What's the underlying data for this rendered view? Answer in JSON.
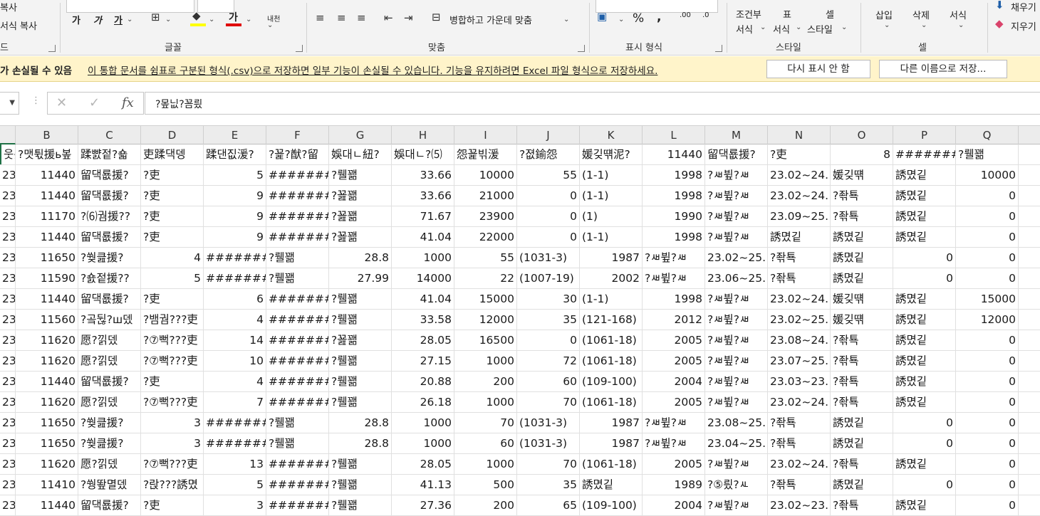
{
  "ribbon": {
    "clipboard": {
      "copy_label": "복사",
      "format_painter_label": "서식 복사",
      "group_label": "드"
    },
    "font": {
      "bold": "가",
      "italic": "가",
      "underline": "가",
      "group_label": "글꼴",
      "wrap": "내천"
    },
    "alignment": {
      "merge_label": "병합하고 가운데 맞춤",
      "group_label": "맞춤"
    },
    "number": {
      "percent": "%",
      "comma": ",",
      "inc_decimal": ".00",
      "dec_decimal": ".0",
      "group_label": "표시 형식"
    },
    "styles": {
      "conditional_line1": "조건부",
      "conditional_line2": "서식",
      "table_line1": "표",
      "table_line2": "서식",
      "cell_line1": "셀",
      "cell_line2": "스타일",
      "group_label": "스타일"
    },
    "cells": {
      "insert": "삽입",
      "delete": "삭제",
      "format": "서식",
      "group_label": "셀"
    },
    "editing": {
      "fill": "채우기",
      "clear": "지우기"
    }
  },
  "message_bar": {
    "title": "가 손실될 수 있음",
    "text": "이 통합 문서를 쉼표로 구분된 형식(.csv)으로 저장하면 일부 기능이 손실될 수 있습니다. 기능을 유지하려면 Excel 파일 형식으로 저장하세요.",
    "dont_show_button": "다시 표시 안 함",
    "save_as_button": "다른 이름으로 저장..."
  },
  "formula_bar": {
    "cancel_icon": "✕",
    "enter_icon": "✓",
    "fx_label": "fx",
    "content": "?뫂닚?꾬릤"
  },
  "columns": [
    "B",
    "C",
    "D",
    "E",
    "F",
    "G",
    "H",
    "I",
    "J",
    "K",
    "L",
    "M",
    "N",
    "O",
    "P",
    "Q"
  ],
  "rows": [
    [
      "웃릤",
      "?맷튃援ь봎",
      "蹂뺤젙?숇",
      "吏蹂댁뎅",
      "蹂댄짒湲?",
      "?꾩?猷?留",
      "娛대ㄴ紐?",
      "娛대ㄴ?⑸",
      "怨꾩빆湲",
      "?졊鍮怨",
      "媛깆떆泥?",
      "11440",
      "留댁룞援?",
      "?吏",
      "8",
      "#######",
      "?뤨꽮"
    ],
    [
      "23",
      "11440",
      "留댁룞援?",
      "?吏",
      "5",
      "#######",
      "?뤨꽮",
      "33.66",
      "10000",
      "55",
      "(1-1)",
      "1998",
      "?ㅽ뷮?ㅽ",
      "23.02~24.",
      "媛깆떆",
      "誘몄깉",
      "10000"
    ],
    [
      "23",
      "11440",
      "留댁룞援?",
      "?吏",
      "9",
      "#######",
      "?꾪꽮",
      "33.66",
      "21000",
      "0",
      "(1-1)",
      "1998",
      "?ㅽ뷮?ㅽ",
      "23.02~24.",
      "?좎툑",
      "誘몄깉",
      "0"
    ],
    [
      "23",
      "11170",
      "?⑹궘援??",
      "?吏",
      "9",
      "#######",
      "?꾪꽮",
      "71.67",
      "23900",
      "0",
      "(1)",
      "1990",
      "?ㅽ뷮?ㅽ",
      "23.09~25.",
      "?좎툑",
      "誘몄깉",
      "0"
    ],
    [
      "23",
      "11440",
      "留댁룞援?",
      "?吏",
      "9",
      "#######",
      "?꾪꽮",
      "41.04",
      "22000",
      "0",
      "(1-1)",
      "1998",
      "?ㅽ뷮?ㅽ",
      "誘몄깉",
      "誘몄깉",
      "誘몄깉",
      "0"
    ],
    [
      "23",
      "11650",
      "?쒖큺援?",
      "4",
      "#######",
      "?뤨꽮",
      "28.8",
      "1000",
      "55",
      "(1031-3)",
      "1987",
      "?ㅽ뷮?ㅽ",
      "23.02~25.",
      "?좎툑",
      "誘몄깉",
      "0",
      "0"
    ],
    [
      "23",
      "11590",
      "?숈젙援??",
      "5",
      "#######",
      "?뤨꽮",
      "27.99",
      "14000",
      "22",
      "(1007-19)",
      "2002",
      "?ㅽ뷮?ㅽ",
      "23.06~25.",
      "?좎툑",
      "誘몄깉",
      "0",
      "0"
    ],
    [
      "23",
      "11440",
      "留댁룞援?",
      "?吏",
      "6",
      "#######",
      "?뤨꽮",
      "41.04",
      "15000",
      "30",
      "(1-1)",
      "1998",
      "?ㅽ뷮?ㅽ",
      "23.02~24.",
      "媛깆떆",
      "誘몄깉",
      "15000"
    ],
    [
      "23",
      "11560",
      "?곸뒪?ш뎄",
      "?뱀궘???吏",
      "4",
      "#######",
      "?뤨꽮",
      "33.58",
      "12000",
      "35",
      "(121-168)",
      "2012",
      "?ㅽ뷮?ㅽ",
      "23.02~25.",
      "媛깆떆",
      "誘몄깉",
      "12000"
    ],
    [
      "23",
      "11620",
      "愿?낅뎄",
      "?⑦뻑???吏",
      "14",
      "#######",
      "?꾪꽮",
      "28.05",
      "16500",
      "0",
      "(1061-18)",
      "2005",
      "?ㅽ뷮?ㅽ",
      "23.08~24.",
      "?좎툑",
      "誘몄깉",
      "0"
    ],
    [
      "23",
      "11620",
      "愿?낅뎄",
      "?⑦뻑???吏",
      "10",
      "#######",
      "?뤨꽮",
      "27.15",
      "1000",
      "72",
      "(1061-18)",
      "2005",
      "?ㅽ뷮?ㅽ",
      "23.07~25.",
      "?좎툑",
      "誘몄깉",
      "0"
    ],
    [
      "23",
      "11440",
      "留댁룞援?",
      "?吏",
      "4",
      "#######",
      "?뤨꽮",
      "20.88",
      "200",
      "60",
      "(109-100)",
      "2004",
      "?ㅽ뷮?ㅽ",
      "23.03~23.",
      "?좎툑",
      "誘몄깉",
      "0"
    ],
    [
      "23",
      "11620",
      "愿?낅뎄",
      "?⑦뻑???吏",
      "7",
      "#######",
      "?뤨꽮",
      "26.18",
      "1000",
      "70",
      "(1061-18)",
      "2005",
      "?ㅽ뷮?ㅽ",
      "23.02~24.",
      "?좎툑",
      "誘몄깉",
      "0"
    ],
    [
      "23",
      "11650",
      "?쒖큺援?",
      "3",
      "#######",
      "?뤨꽮",
      "28.8",
      "1000",
      "70",
      "(1031-3)",
      "1987",
      "?ㅽ뷮?ㅽ",
      "23.08~25.",
      "?좎툑",
      "誘몄깉",
      "0",
      "0"
    ],
    [
      "23",
      "11650",
      "?쒖큺援?",
      "3",
      "#######",
      "?뤨꽮",
      "28.8",
      "1000",
      "60",
      "(1031-3)",
      "1987",
      "?ㅽ뷮?ㅽ",
      "23.04~25.",
      "?좎툑",
      "誘몄깉",
      "0",
      "0"
    ],
    [
      "23",
      "11620",
      "愿?낅뎄",
      "?⑦뻑???吏",
      "13",
      "#######",
      "?뤨꽮",
      "28.05",
      "1000",
      "70",
      "(1061-18)",
      "2005",
      "?ㅽ뷮?ㅽ",
      "23.02~24.",
      "?좎툑",
      "誘몄깉",
      "0"
    ],
    [
      "23",
      "11410",
      "?쒕뙆멸뎄",
      "?랁???誘몄",
      "5",
      "#######",
      "?뤨꽮",
      "41.13",
      "500",
      "35",
      "誘몄깉",
      "1989",
      "?⑤릤?ㅻ",
      "?좎툑",
      "誘몄깉",
      "0",
      "0"
    ],
    [
      "23",
      "11440",
      "留댁룞援?",
      "?吏",
      "3",
      "#######",
      "?뤨꽮",
      "27.36",
      "200",
      "65",
      "(109-100)",
      "2004",
      "?ㅽ뷮?ㅽ",
      "23.02~23.",
      "?좎툑",
      "誘몄깉",
      "0"
    ]
  ]
}
